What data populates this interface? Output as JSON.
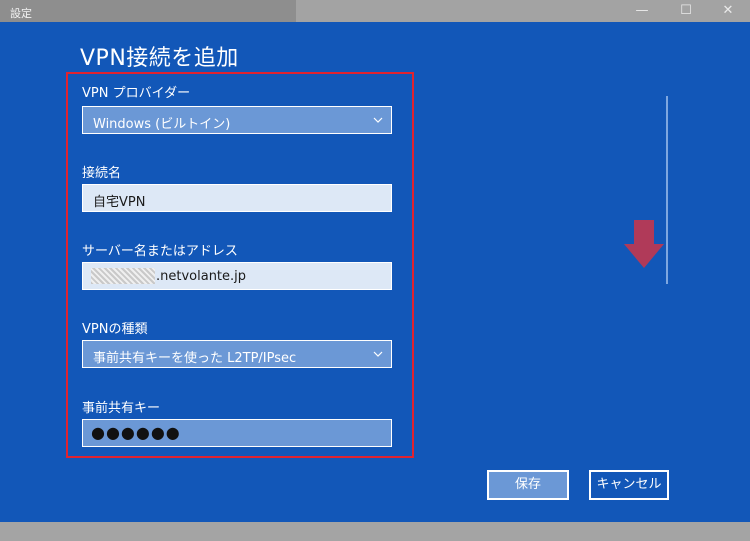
{
  "window": {
    "title": "設定",
    "minimize": "—",
    "maximize": "☐",
    "close": "✕"
  },
  "dialog": {
    "title": "VPN接続を追加",
    "fields": {
      "provider": {
        "label": "VPN プロバイダー",
        "value": "Windows (ビルトイン)"
      },
      "connection_name": {
        "label": "接続名",
        "value": "自宅VPN"
      },
      "server": {
        "label": "サーバー名またはアドレス",
        "value_suffix": ".netvolante.jp"
      },
      "vpn_type": {
        "label": "VPNの種類",
        "value": "事前共有キーを使った L2TP/IPsec"
      },
      "psk": {
        "label": "事前共有キー",
        "value": "●●●●●●"
      }
    },
    "buttons": {
      "save": "保存",
      "cancel": "キャンセル"
    }
  },
  "colors": {
    "dialog_bg": "#1257b8",
    "highlight_frame": "#e0232f",
    "arrow": "#b03a59"
  },
  "icons": [
    "chevron-down-icon",
    "down-arrow-icon"
  ]
}
